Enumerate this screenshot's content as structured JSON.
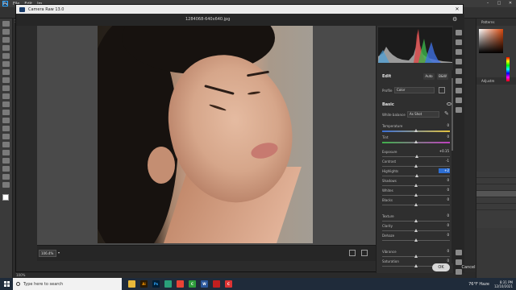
{
  "ps": {
    "logo": "Ps",
    "menu": [
      "File",
      "Edit",
      "Im"
    ],
    "doc_tab": "1284068-6",
    "status_zoom": "100%",
    "panels": {
      "patterns": "Patterns",
      "adjust": "Adjustm"
    },
    "layers": [
      "",
      "",
      "",
      "",
      "",
      ""
    ]
  },
  "camera_raw": {
    "title": "Camera Raw 13.0",
    "filename": "1284068-640x640.jpg",
    "zoom": "106.4%",
    "edit_label": "Edit",
    "auto_label": "Auto",
    "bw_label": "B&W",
    "profile_label": "Profile",
    "profile_value": "Color",
    "basic_label": "Basic",
    "white_balance_label": "White balance",
    "white_balance_value": "As Shot",
    "sliders": [
      {
        "label": "Temperature",
        "value": "0",
        "pos": 0.5,
        "kind": "temp"
      },
      {
        "label": "Tint",
        "value": "0",
        "pos": 0.5,
        "kind": "tint"
      },
      {
        "label": "Exposure",
        "value": "+0.15",
        "pos": 0.51,
        "kind": ""
      },
      {
        "label": "Contrast",
        "value": "-1",
        "pos": 0.495,
        "kind": ""
      },
      {
        "label": "Highlights",
        "value": "+2",
        "pos": 0.51,
        "kind": "",
        "active": true
      },
      {
        "label": "Shadows",
        "value": "0",
        "pos": 0.5,
        "kind": ""
      },
      {
        "label": "Whites",
        "value": "0",
        "pos": 0.5,
        "kind": ""
      },
      {
        "label": "Blacks",
        "value": "0",
        "pos": 0.5,
        "kind": ""
      },
      {
        "label": "Texture",
        "value": "0",
        "pos": 0.5,
        "kind": ""
      },
      {
        "label": "Clarity",
        "value": "0",
        "pos": 0.5,
        "kind": ""
      },
      {
        "label": "Dehaze",
        "value": "0",
        "pos": 0.5,
        "kind": ""
      },
      {
        "label": "Vibrance",
        "value": "0",
        "pos": 0.5,
        "kind": ""
      },
      {
        "label": "Saturation",
        "value": "0",
        "pos": 0.5,
        "kind": ""
      }
    ],
    "ok_label": "OK",
    "cancel_label": "Cancel"
  },
  "taskbar": {
    "search_placeholder": "Type here to search",
    "weather": "76°F Haze",
    "time": "8:31 PM",
    "date": "12/10/2021",
    "apps": [
      {
        "name": "file-explorer-icon",
        "glyph": "",
        "bg": "#e8b93a",
        "fg": "#000"
      },
      {
        "name": "illustrator-icon",
        "glyph": "Ai",
        "bg": "#2b1a00",
        "fg": "#ff9a00"
      },
      {
        "name": "photoshop-icon",
        "glyph": "Ps",
        "bg": "#001e36",
        "fg": "#31a8ff"
      },
      {
        "name": "edge-icon",
        "glyph": "",
        "bg": "#2aa07a",
        "fg": "#fff"
      },
      {
        "name": "chrome-icon",
        "glyph": "",
        "bg": "#ea4335",
        "fg": "#fff"
      },
      {
        "name": "camtasia-icon",
        "glyph": "C",
        "bg": "#2e9c3b",
        "fg": "#fff"
      },
      {
        "name": "word-icon",
        "glyph": "W",
        "bg": "#2b579a",
        "fg": "#fff"
      },
      {
        "name": "app-red-icon",
        "glyph": "",
        "bg": "#c21f1f",
        "fg": "#fff"
      },
      {
        "name": "recorder-icon",
        "glyph": "C",
        "bg": "#d33",
        "fg": "#fff"
      }
    ]
  }
}
